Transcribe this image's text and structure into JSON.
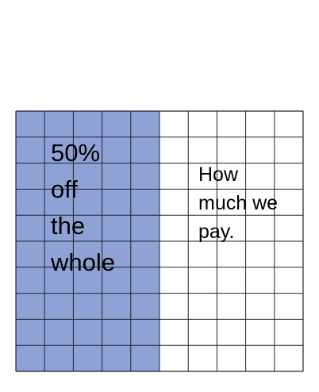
{
  "diagram": {
    "grid": {
      "columns": 10,
      "rows": 10,
      "shaded_columns": 5,
      "shaded_fraction": 0.5,
      "shade_color": "#8ea2d6",
      "line_color": "#1f2333",
      "background_color": "#ffffff"
    },
    "shaded_label": {
      "lines": [
        "50%",
        "off",
        "the",
        "whole"
      ]
    },
    "unshaded_label": {
      "lines": [
        "How",
        "much we",
        "pay."
      ]
    }
  }
}
